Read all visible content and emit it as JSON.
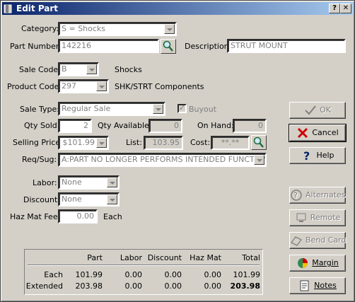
{
  "window": {
    "title": "Edit Part",
    "help_glyph": "?",
    "close_glyph": "✕"
  },
  "form": {
    "category": {
      "label": "Category:",
      "value": "S = Shocks"
    },
    "part_number": {
      "label": "Part Number:",
      "value": "142216"
    },
    "description": {
      "label": "Description:",
      "value": "STRUT MOUNT"
    },
    "sale_code": {
      "label": "Sale Code:",
      "value": "B",
      "text": "Shocks"
    },
    "product_code": {
      "label": "Product Code:",
      "value": "297",
      "text": "SHK/STRT Components"
    },
    "sale_type": {
      "label": "Sale Type:",
      "value": "Regular Sale"
    },
    "buyout": {
      "label": "Buyout",
      "checked": true
    },
    "qty_sold": {
      "label": "Qty Sold:",
      "value": "2"
    },
    "qty_available": {
      "label": "Qty Available:",
      "value": "0"
    },
    "on_hand": {
      "label": "On Hand:",
      "value": "0"
    },
    "selling_price": {
      "label": "Selling Price:",
      "value": "$101.99"
    },
    "list": {
      "label": "List:",
      "value": "103.95"
    },
    "cost": {
      "label": "Cost:",
      "value": "**.**"
    },
    "req_sug": {
      "label": "Req/Sug:",
      "value": "A:PART NO LONGER PERFORMS INTENDED FUNCTION"
    },
    "labor": {
      "label": "Labor:",
      "value": "None"
    },
    "discount": {
      "label": "Discount:",
      "value": "None"
    },
    "haz_mat_fee": {
      "label": "Haz Mat Fee:",
      "value": "0.00",
      "suffix": "Each"
    }
  },
  "buttons": {
    "ok": "OK",
    "cancel": "Cancel",
    "help": "Help",
    "alternates": "Alternates",
    "remote": "Remote",
    "bend_card": "Bend Card",
    "margin": "Margin",
    "notes": "Notes"
  },
  "summary": {
    "headers": [
      "Part",
      "Labor",
      "Discount",
      "Haz Mat",
      "Total"
    ],
    "rows": [
      {
        "label": "Each",
        "values": [
          "101.99",
          "0.00",
          "0.00",
          "0.00",
          "101.99"
        ]
      },
      {
        "label": "Extended",
        "values": [
          "203.98",
          "0.00",
          "0.00",
          "0.00",
          "203.98"
        ]
      }
    ]
  },
  "colors": {
    "titlebar_start": "#0a246a",
    "titlebar_end": "#a6caf0",
    "face": "#d4d0c8",
    "cancel_icon": "#cc0000",
    "ok_icon": "#808080"
  }
}
